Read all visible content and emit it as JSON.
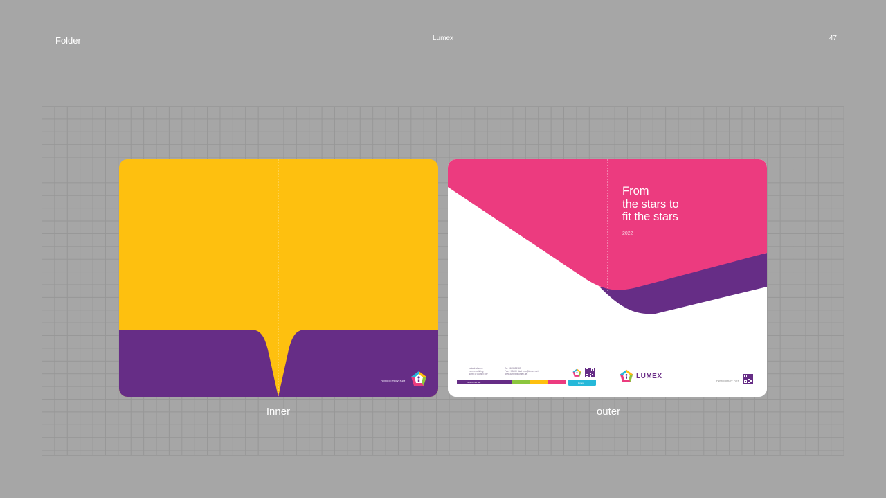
{
  "header": {
    "section_title": "Folder",
    "brand": "Lumex",
    "page_number": "47"
  },
  "inner": {
    "caption": "Inner",
    "url": "new.lumex.net"
  },
  "outer": {
    "caption": "outer",
    "tagline": "From\nthe stars to\nfit the stars",
    "year": "2022",
    "brand_word": "LUMEX",
    "url": "new.lumex.net",
    "contact_lines": [
      "Tel: 0123456789",
      "Fax: +00000 Mail: info@lumex.net",
      "www.lumex@lumex.net"
    ],
    "address_lines": [
      "Industrial zone",
      "Lumex building",
      "North of Lumex city"
    ],
    "bar_label": "new.lumex.net",
    "chip_label": "lumex"
  },
  "colors": {
    "background": "#a6a6a6",
    "yellow": "#fec00f",
    "purple": "#662d86",
    "pink": "#ec3b7f",
    "green": "#8cc63e",
    "cyan": "#25b8d9",
    "white": "#ffffff"
  },
  "icons": [
    "lumex-logo-icon",
    "qr-code-icon"
  ]
}
